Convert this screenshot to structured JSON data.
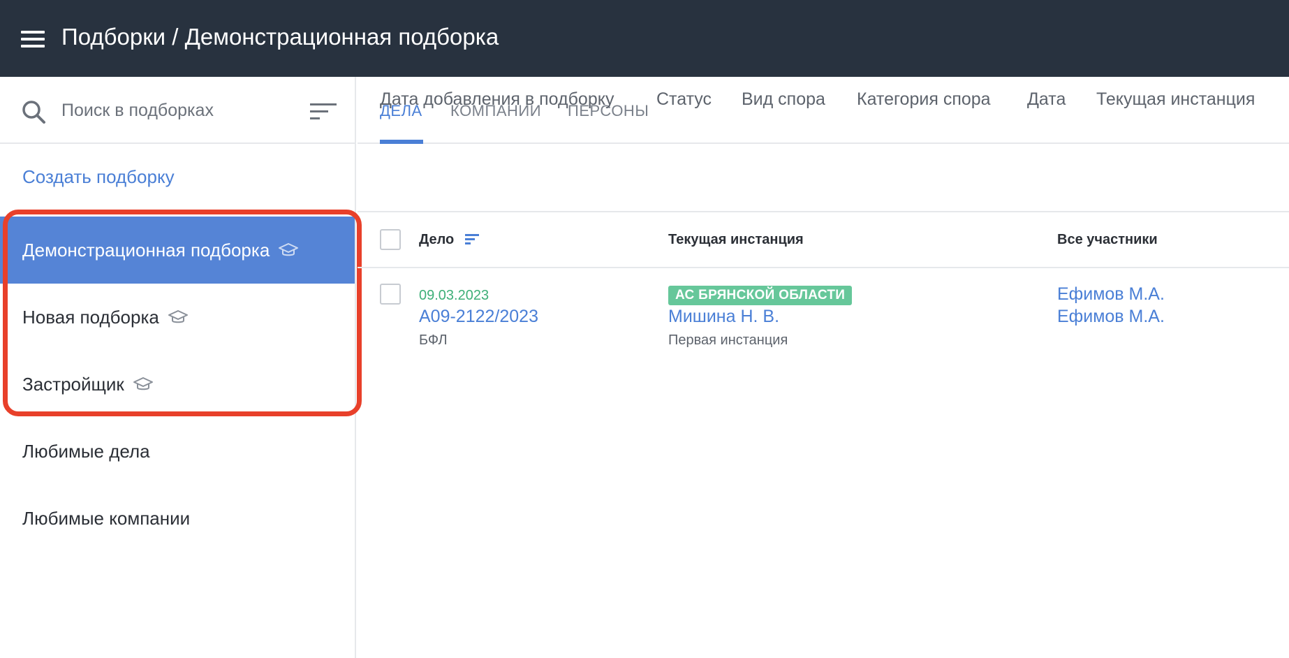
{
  "header": {
    "title": "Подборки / Демонстрационная подборка"
  },
  "sidebar": {
    "search_placeholder": "Поиск в подборках",
    "create_label": "Создать подборку",
    "items": [
      {
        "label": "Демонстрационная подборка",
        "icon": "graduation-cap-icon",
        "active": true
      },
      {
        "label": "Новая подборка",
        "icon": "graduation-cap-icon",
        "active": false
      },
      {
        "label": "Застройщик",
        "icon": "graduation-cap-icon",
        "active": false
      },
      {
        "label": "Любимые дела",
        "icon": null,
        "active": false
      },
      {
        "label": "Любимые компании",
        "icon": null,
        "active": false
      }
    ]
  },
  "tabs": [
    {
      "label": "ДЕЛА",
      "active": true
    },
    {
      "label": "КОМПАНИИ",
      "active": false
    },
    {
      "label": "ПЕРСОНЫ",
      "active": false
    }
  ],
  "filters": [
    "Дата добавления в подборку",
    "Статус",
    "Вид спора",
    "Категория спора",
    "Дата",
    "Текущая инстанция"
  ],
  "table": {
    "columns": [
      "Дело",
      "Текущая инстанция",
      "Все участники"
    ],
    "rows": [
      {
        "date": "09.03.2023",
        "case_number": "А09-2122/2023",
        "case_type": "БФЛ",
        "court": "АС БРЯНСКОЙ ОБЛАСТИ",
        "judge": "Мишина Н. В.",
        "instance": "Первая инстанция",
        "participants": [
          "Ефимов М.А.",
          "Ефимов М.А."
        ]
      }
    ]
  },
  "colors": {
    "topbar": "#28323f",
    "accent": "#4a7fd6",
    "active_item": "#5584d6",
    "badge": "#66c79a",
    "date": "#3eaf78",
    "highlight": "#e8402a"
  }
}
